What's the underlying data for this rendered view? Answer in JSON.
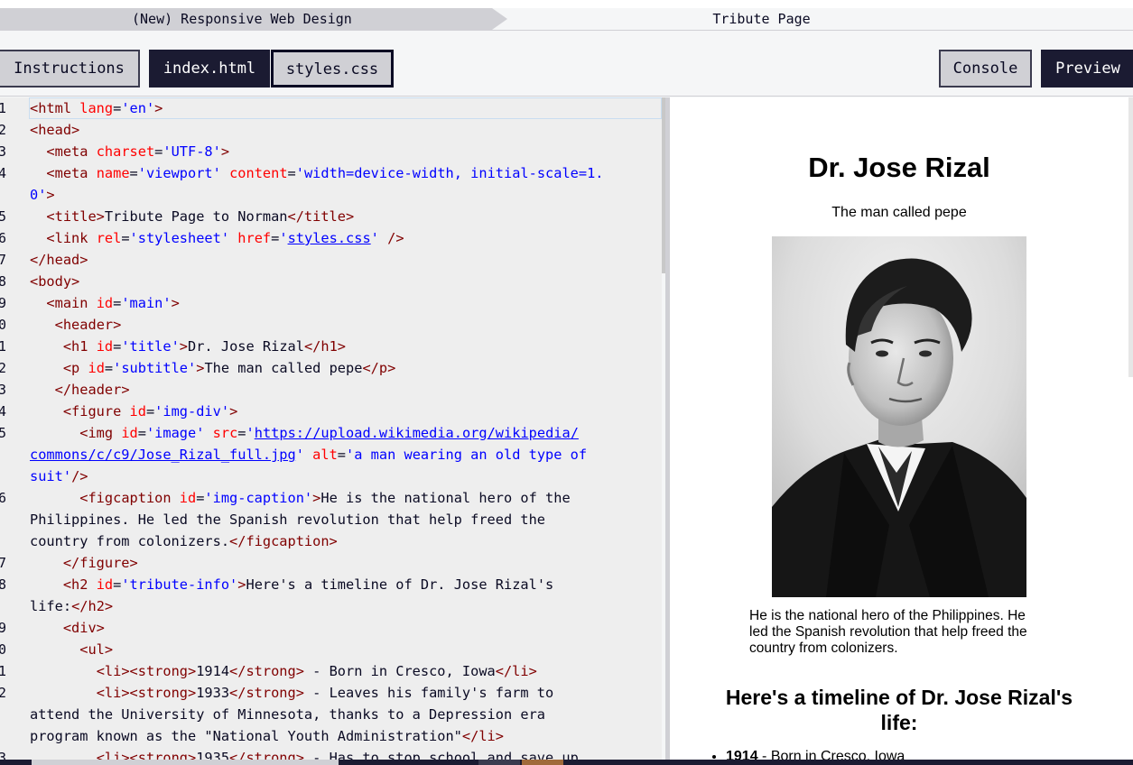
{
  "breadcrumb": {
    "super_block": "(New) Responsive Web Design",
    "challenge": "Tribute Page"
  },
  "tabs": {
    "instructions": "Instructions",
    "index_html": "index.html",
    "styles_css": "styles.css",
    "console": "Console",
    "preview": "Preview"
  },
  "editor": {
    "line_numbers": [
      "1",
      "2",
      "3",
      "4",
      "",
      "5",
      "6",
      "7",
      "8",
      "9",
      "0",
      "1",
      "2",
      "3",
      "4",
      "5",
      "",
      "",
      "6",
      "",
      "",
      "7",
      "8",
      "",
      "9",
      "0",
      "1",
      "2",
      "",
      "",
      "3"
    ]
  },
  "preview": {
    "title": "Dr. Jose Rizal",
    "subtitle": "The man called pepe",
    "caption": "He is the national hero of the Philippines. He led the Spanish revolution that help freed the country from colonizers.",
    "timeline_heading": "Here's a timeline of Dr. Jose Rizal's life:",
    "first_item_year": "1914",
    "first_item_text": " - Born in Cresco, Iowa"
  },
  "colors": {
    "tag": "#800000",
    "attribute": "#ff0000",
    "string": "#0000ff",
    "dark_tab": "#1b1b32",
    "light_tab": "#d0d0d5"
  }
}
